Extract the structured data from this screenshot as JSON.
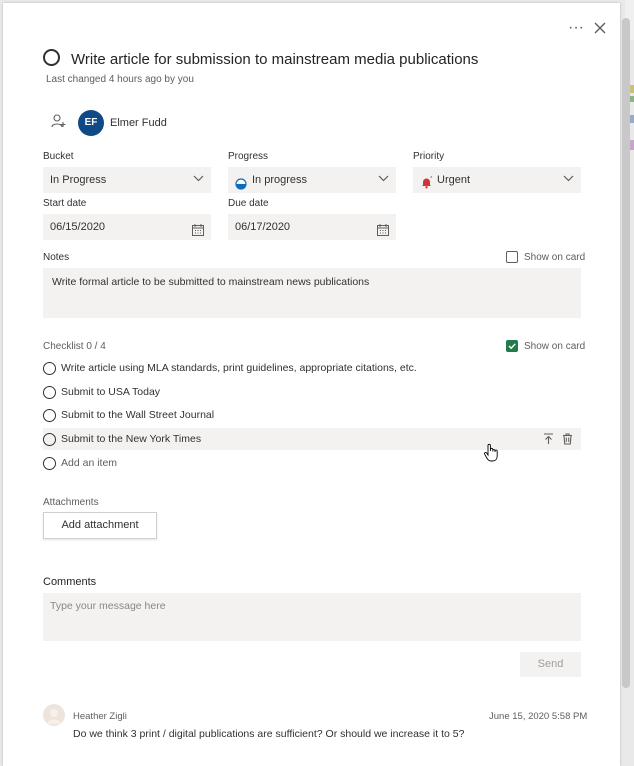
{
  "task": {
    "title": "Write article for submission to mainstream media publications",
    "last_changed": "Last changed 4 hours ago by you"
  },
  "assignee": {
    "initials": "EF",
    "name": "Elmer Fudd",
    "avatar_color": "#0f4a86"
  },
  "fields": {
    "bucket": {
      "label": "Bucket",
      "value": "In Progress"
    },
    "progress": {
      "label": "Progress",
      "value": "In progress"
    },
    "priority": {
      "label": "Priority",
      "value": "Urgent",
      "color": "#d13438"
    },
    "start_date": {
      "label": "Start date",
      "value": "06/15/2020"
    },
    "due_date": {
      "label": "Due date",
      "value": "06/17/2020"
    }
  },
  "notes": {
    "label": "Notes",
    "show_on_card": "Show on card",
    "text": "Write formal article to be submitted to mainstream news publications"
  },
  "checklist": {
    "label": "Checklist 0 / 4",
    "show_on_card": "Show on card",
    "accent": "#237b4b",
    "items": [
      "Write article using MLA standards, print guidelines, appropriate citations, etc.",
      "Submit to USA Today",
      "Submit to the Wall Street Journal",
      "Submit to the New York Times"
    ],
    "add_placeholder": "Add an item"
  },
  "attachments": {
    "label": "Attachments",
    "add_button": "Add attachment"
  },
  "comments": {
    "label": "Comments",
    "placeholder": "Type your message here",
    "send": "Send",
    "entries": [
      {
        "author": "Heather Zigli",
        "date": "June 15, 2020 5:58 PM",
        "text": "Do we think 3 print / digital publications are sufficient? Or should we increase it to 5?"
      }
    ]
  },
  "icons": {
    "more": "more-icon",
    "close": "close-icon",
    "assign": "assign-user-icon",
    "calendar": "calendar-icon",
    "move_top": "move-to-top-icon",
    "delete": "trash-icon"
  }
}
